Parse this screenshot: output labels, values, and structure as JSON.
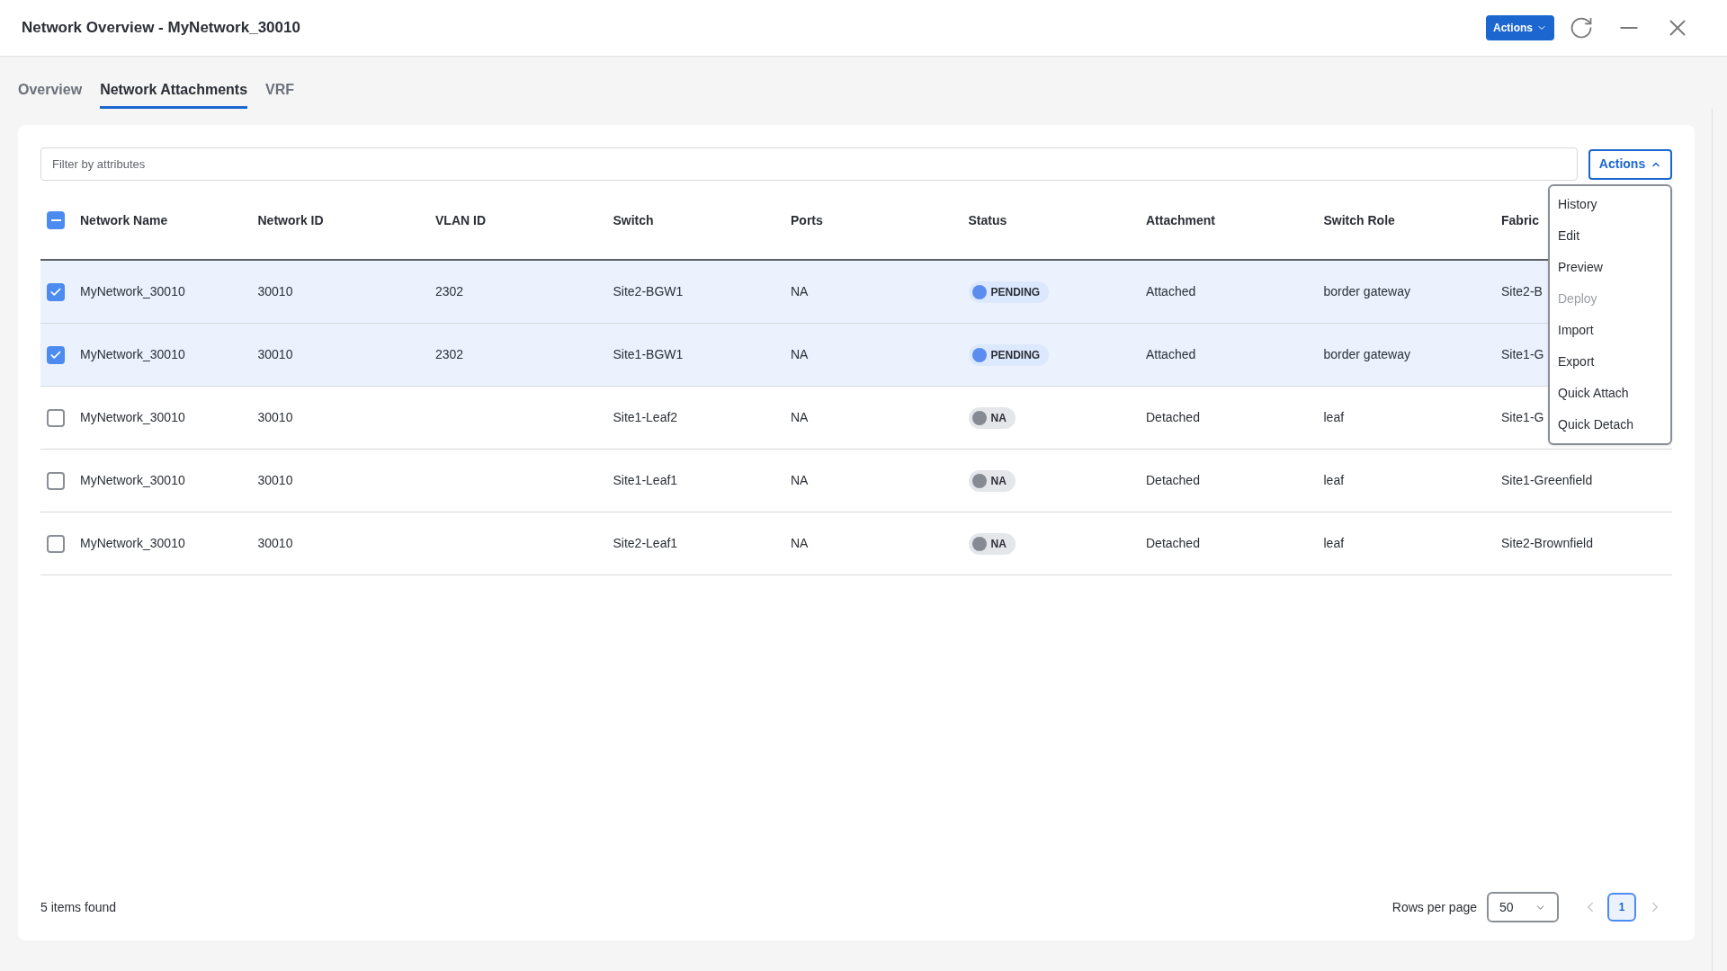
{
  "window": {
    "title": "Network Overview - MyNetwork_30010",
    "actions_label": "Actions"
  },
  "tabs": [
    {
      "label": "Overview",
      "selected": false
    },
    {
      "label": "Network Attachments",
      "selected": true
    },
    {
      "label": "VRF",
      "selected": false
    }
  ],
  "filter": {
    "placeholder": "Filter by attributes"
  },
  "actions_button": {
    "label": "Actions",
    "expanded": true
  },
  "actions_menu": [
    {
      "label": "History",
      "disabled": false
    },
    {
      "label": "Edit",
      "disabled": false
    },
    {
      "label": "Preview",
      "disabled": false
    },
    {
      "label": "Deploy",
      "disabled": true
    },
    {
      "label": "Import",
      "disabled": false
    },
    {
      "label": "Export",
      "disabled": false
    },
    {
      "label": "Quick Attach",
      "disabled": false
    },
    {
      "label": "Quick Detach",
      "disabled": false
    }
  ],
  "table": {
    "header_checkbox": {
      "indeterminate": true
    },
    "columns": [
      "Network Name",
      "Network ID",
      "VLAN ID",
      "Switch",
      "Ports",
      "Status",
      "Attachment",
      "Switch Role",
      "Fabric"
    ],
    "rows": [
      {
        "selected": true,
        "cells": [
          "MyNetwork_30010",
          "30010",
          "2302",
          "Site2-BGW1",
          "NA"
        ],
        "status": {
          "label": "PENDING",
          "kind": "pending"
        },
        "rest": [
          "Attached",
          "border gateway",
          "Site2-B"
        ]
      },
      {
        "selected": true,
        "cells": [
          "MyNetwork_30010",
          "30010",
          "2302",
          "Site1-BGW1",
          "NA"
        ],
        "status": {
          "label": "PENDING",
          "kind": "pending"
        },
        "rest": [
          "Attached",
          "border gateway",
          "Site1-G"
        ]
      },
      {
        "selected": false,
        "cells": [
          "MyNetwork_30010",
          "30010",
          "",
          "Site1-Leaf2",
          "NA"
        ],
        "status": {
          "label": "NA",
          "kind": "na"
        },
        "rest": [
          "Detached",
          "leaf",
          "Site1-G"
        ]
      },
      {
        "selected": false,
        "cells": [
          "MyNetwork_30010",
          "30010",
          "",
          "Site1-Leaf1",
          "NA"
        ],
        "status": {
          "label": "NA",
          "kind": "na"
        },
        "rest": [
          "Detached",
          "leaf",
          "Site1-Greenfield"
        ]
      },
      {
        "selected": false,
        "cells": [
          "MyNetwork_30010",
          "30010",
          "",
          "Site2-Leaf1",
          "NA"
        ],
        "status": {
          "label": "NA",
          "kind": "na"
        },
        "rest": [
          "Detached",
          "leaf",
          "Site2-Brownfield"
        ]
      }
    ]
  },
  "footer": {
    "count": "5 items found",
    "rows_per_page_label": "Rows per page",
    "rows_per_page": "50",
    "pages": [
      {
        "label": "1",
        "selected": true
      }
    ]
  }
}
